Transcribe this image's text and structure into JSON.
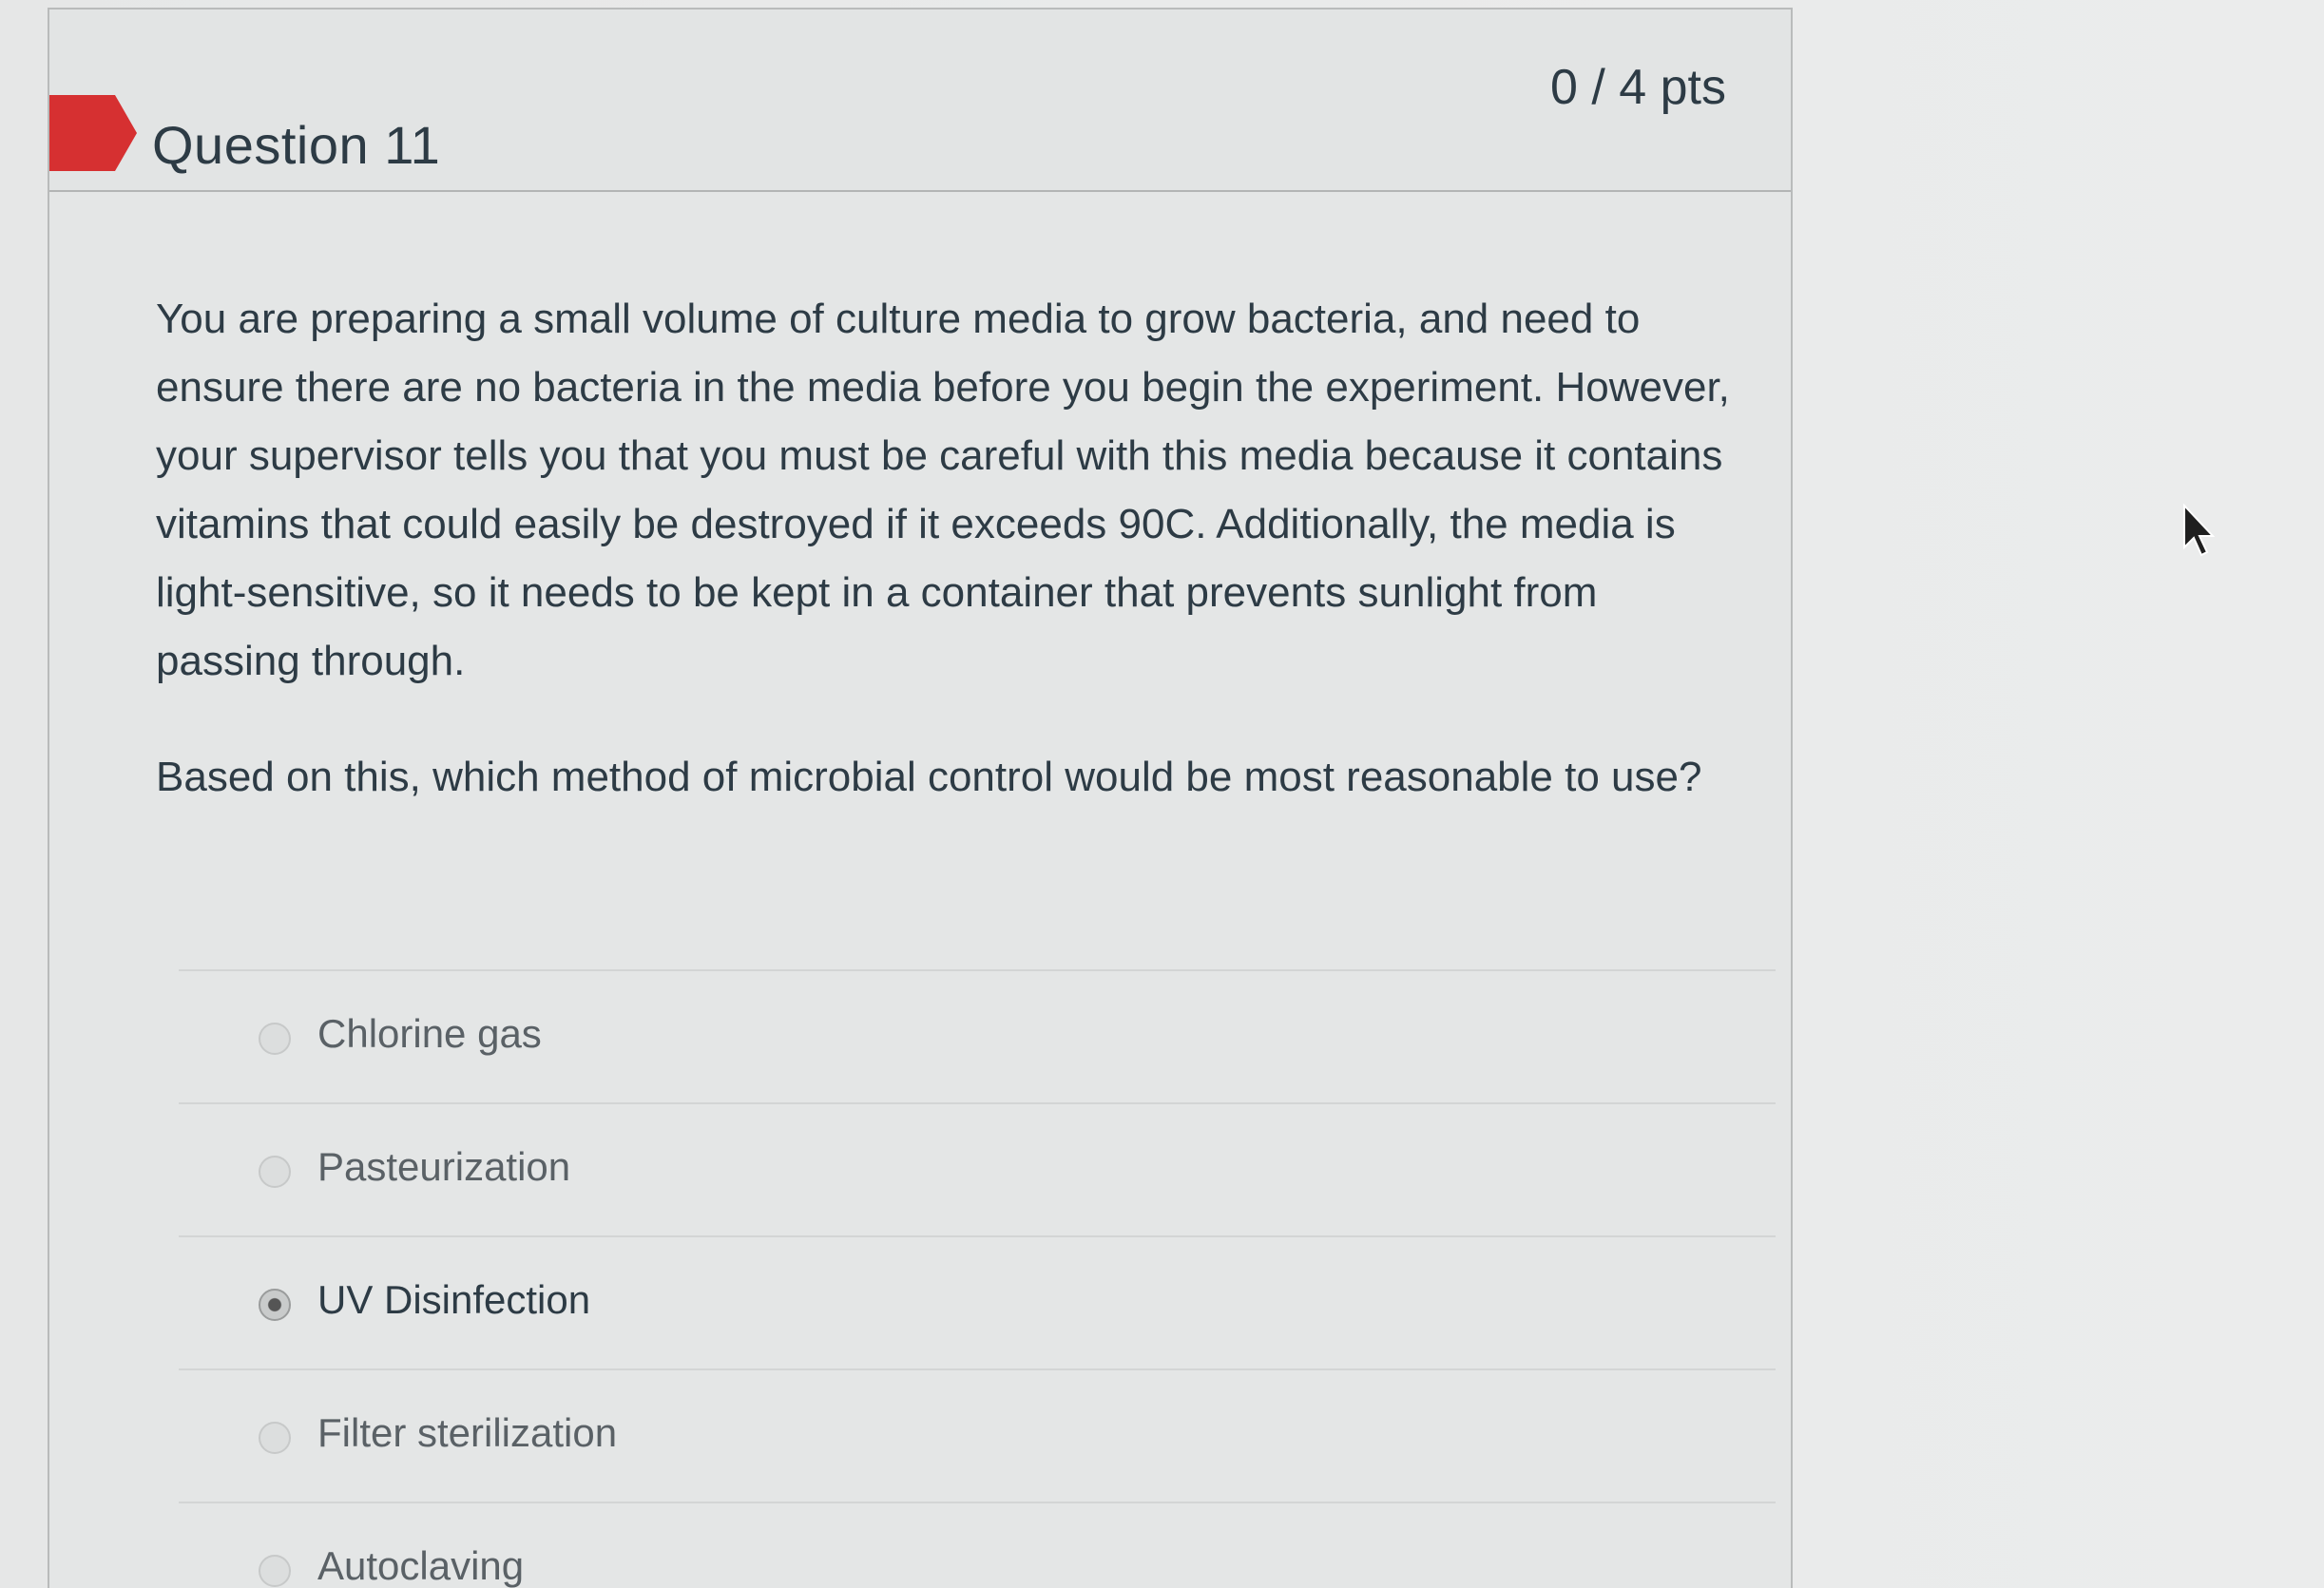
{
  "question": {
    "title": "Question 11",
    "points": "0 / 4 pts",
    "paragraph1": "You are preparing a small volume of culture media to grow bacteria, and need to ensure there are no bacteria in the media before you begin the experiment. However, your supervisor tells you that you must be careful with this media because it contains vitamins that could easily be destroyed if it exceeds 90C. Additionally, the media is light-sensitive, so it needs to be kept in a container that prevents sunlight from passing through.",
    "paragraph2": "Based on this, which method of microbial control would be most reasonable to use?"
  },
  "answers": [
    {
      "label": "Chlorine gas",
      "selected": false
    },
    {
      "label": "Pasteurization",
      "selected": false
    },
    {
      "label": "UV Disinfection",
      "selected": true
    },
    {
      "label": "Filter sterilization",
      "selected": false
    },
    {
      "label": "Autoclaving",
      "selected": false
    }
  ],
  "colors": {
    "flag": "#d63031",
    "text": "#2d3b45"
  }
}
